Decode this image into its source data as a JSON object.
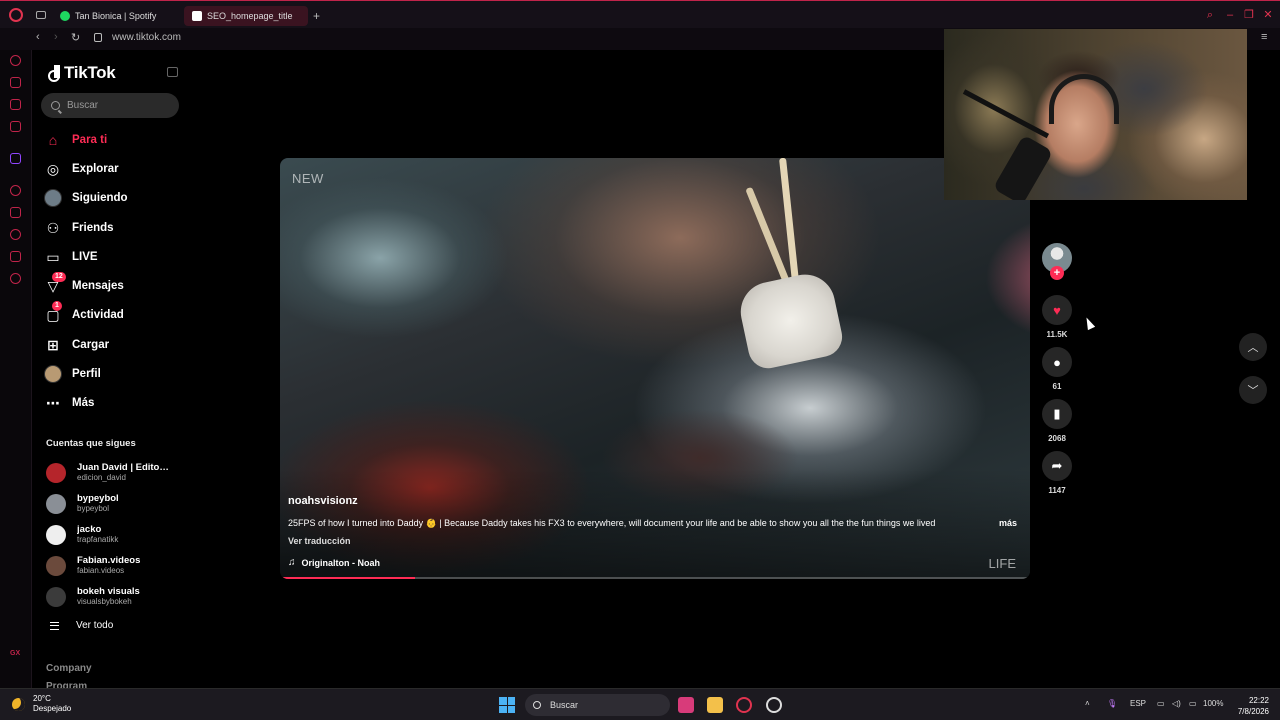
{
  "browser": {
    "tabs": [
      {
        "label": "Tan Bionica | Spotify"
      },
      {
        "label": "SEO_homepage_title"
      }
    ],
    "url": "www.tiktok.com",
    "new_tab": "+"
  },
  "tiktok": {
    "logo": "TikTok",
    "search_placeholder": "Buscar",
    "nav": [
      {
        "label": "Para ti",
        "icon": "home-icon",
        "active": true
      },
      {
        "label": "Explorar",
        "icon": "compass-icon"
      },
      {
        "label": "Siguiendo",
        "icon": "avatar-icon"
      },
      {
        "label": "Friends",
        "icon": "friends-icon"
      },
      {
        "label": "LIVE",
        "icon": "live-icon"
      },
      {
        "label": "Mensajes",
        "icon": "messages-icon",
        "badge": "12"
      },
      {
        "label": "Actividad",
        "icon": "activity-icon",
        "badge": "1"
      },
      {
        "label": "Cargar",
        "icon": "upload-icon"
      },
      {
        "label": "Perfil",
        "icon": "profile-avatar-icon"
      },
      {
        "label": "Más",
        "icon": "more-icon"
      }
    ],
    "following_title": "Cuentas que sigues",
    "following": [
      {
        "name": "Juan David | Editor ...",
        "handle": "edicion_david",
        "color": "#b5252b"
      },
      {
        "name": "bypeybol",
        "handle": "bypeybol",
        "color": "#8a8f96"
      },
      {
        "name": "jacko",
        "handle": "trapfanatikk",
        "color": "#eeeeee"
      },
      {
        "name": "Fabian.videos",
        "handle": "fabian.videos",
        "color": "#6b4a3c"
      },
      {
        "name": "bokeh visuals",
        "handle": "visualsbybokeh",
        "color": "#3b3b3b"
      }
    ],
    "see_all": "Ver todo",
    "footer": [
      "Company",
      "Program"
    ]
  },
  "video": {
    "new_label": "NEW",
    "life_label": "LIFE",
    "author": "noahsvisionz",
    "description": "25FPS of how I turned into Daddy 👶 | Because Daddy takes his FX3 to everywhere, will document your life and be able to show you all the the fun things we lived",
    "more": "más",
    "translate": "Ver traducción",
    "music": "Originalton - Noah",
    "progress": 0.18
  },
  "actions": {
    "likes": "11.5K",
    "comments": "61",
    "saves": "2068",
    "shares": "1147"
  },
  "taskbar": {
    "temp": "20°C",
    "weather": "Despejado",
    "search": "Buscar",
    "lang": "ESP",
    "battery": "100%",
    "time": "22:22",
    "date": "7/8/2026"
  },
  "colors": {
    "accent": "#fe2c55",
    "opera": "#c0244a"
  }
}
